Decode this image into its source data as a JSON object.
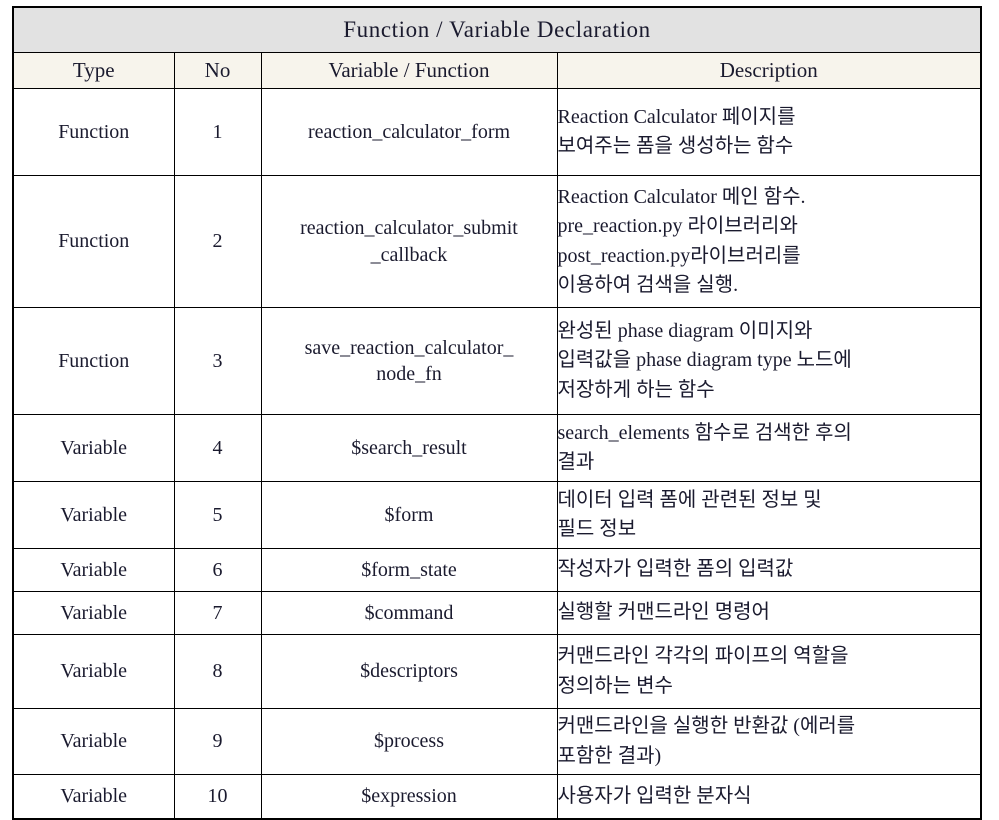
{
  "table": {
    "title": "Function / Variable Declaration",
    "columns": [
      "Type",
      "No",
      "Variable / Function",
      "Description"
    ],
    "rows": [
      {
        "type": "Function",
        "no": "1",
        "variable": "reaction_calculator_form",
        "description": "Reaction Calculator 페이지를\n보여주는 폼을 생성하는 함수"
      },
      {
        "type": "Function",
        "no": "2",
        "variable": "reaction_calculator_submit\n_callback",
        "description": "Reaction Calculator 메인 함수.\npre_reaction.py 라이브러리와\npost_reaction.py라이브러리를\n이용하여 검색을 실행."
      },
      {
        "type": "Function",
        "no": "3",
        "variable": "save_reaction_calculator_\nnode_fn",
        "description": "완성된 phase diagram 이미지와\n입력값을 phase diagram type 노드에\n저장하게 하는 함수"
      },
      {
        "type": "Variable",
        "no": "4",
        "variable": "$search_result",
        "description": "search_elements 함수로 검색한 후의\n결과"
      },
      {
        "type": "Variable",
        "no": "5",
        "variable": "$form",
        "description": "데이터 입력 폼에 관련된 정보 및\n필드 정보"
      },
      {
        "type": "Variable",
        "no": "6",
        "variable": "$form_state",
        "description": "작성자가 입력한 폼의 입력값"
      },
      {
        "type": "Variable",
        "no": "7",
        "variable": "$command",
        "description": "실행할 커맨드라인 명령어"
      },
      {
        "type": "Variable",
        "no": "8",
        "variable": "$descriptors",
        "description": "커맨드라인 각각의 파이프의 역할을\n정의하는 변수"
      },
      {
        "type": "Variable",
        "no": "9",
        "variable": "$process",
        "description": "커맨드라인을 실행한 반환값 (에러를\n포함한 결과)"
      },
      {
        "type": "Variable",
        "no": "10",
        "variable": "$expression",
        "description": "사용자가 입력한 분자식"
      }
    ]
  }
}
